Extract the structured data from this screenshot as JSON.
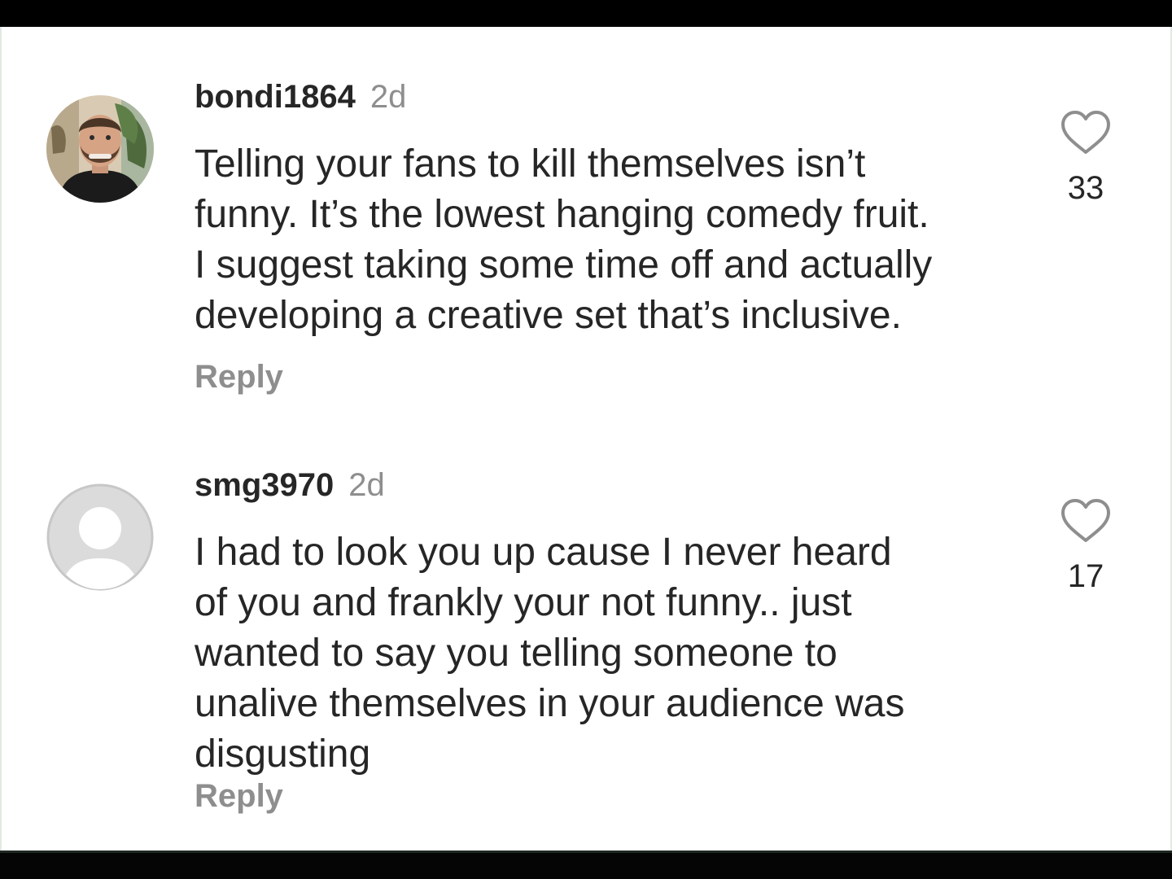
{
  "comments": [
    {
      "username": "bondi1864",
      "time": "2d",
      "lines": [
        "Telling your fans to kill themselves isn’t",
        "funny. It’s the lowest hanging comedy fruit.",
        "I suggest taking some time off and actually",
        "developing a creative set that’s inclusive."
      ],
      "reply_label": "Reply",
      "likes": "33",
      "avatar": "profile-photo"
    },
    {
      "username": "smg3970",
      "time": "2d",
      "lines": [
        "I had to look you up cause I never heard",
        "of you and frankly your not funny.. just",
        "wanted to say you telling someone to",
        "unalive themselves in your audience was",
        "disgusting"
      ],
      "reply_label": "Reply",
      "likes": "17",
      "avatar": "default-avatar-icon"
    }
  ],
  "colors": {
    "text": "#262626",
    "secondary": "#8e8e8e",
    "background": "#ffffff"
  }
}
